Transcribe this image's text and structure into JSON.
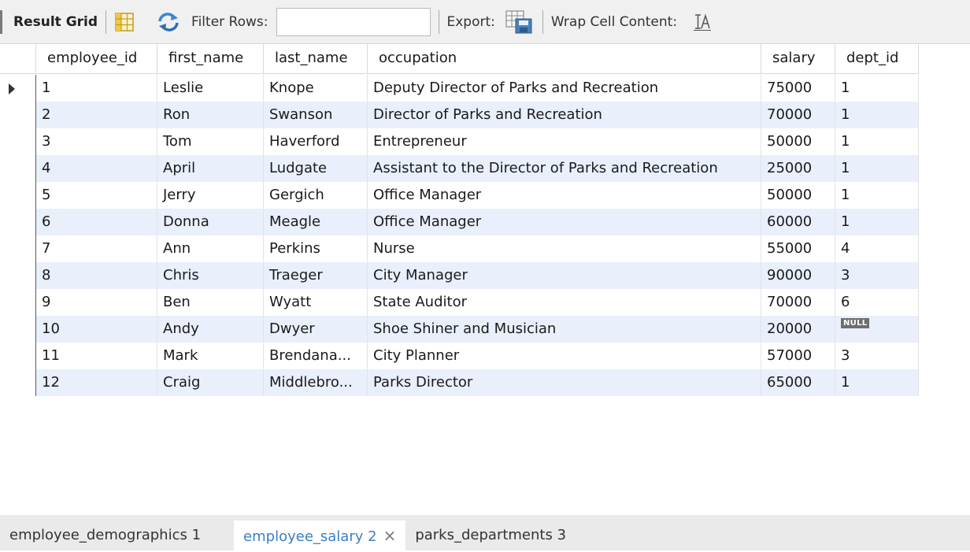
{
  "toolbar": {
    "title": "Result Grid",
    "filter_label": "Filter Rows:",
    "filter_value": "",
    "export_label": "Export:",
    "wrap_label": "Wrap Cell Content:"
  },
  "grid": {
    "columns": [
      "employee_id",
      "first_name",
      "last_name",
      "occupation",
      "salary",
      "dept_id"
    ],
    "rows": [
      {
        "employee_id": "1",
        "first_name": "Leslie",
        "last_name": "Knope",
        "occupation": "Deputy Director of Parks and Recreation",
        "salary": "75000",
        "dept_id": "1"
      },
      {
        "employee_id": "2",
        "first_name": "Ron",
        "last_name": "Swanson",
        "occupation": "Director of Parks and Recreation",
        "salary": "70000",
        "dept_id": "1"
      },
      {
        "employee_id": "3",
        "first_name": "Tom",
        "last_name": "Haverford",
        "occupation": "Entrepreneur",
        "salary": "50000",
        "dept_id": "1"
      },
      {
        "employee_id": "4",
        "first_name": "April",
        "last_name": "Ludgate",
        "occupation": "Assistant to the Director of Parks and Recreation",
        "salary": "25000",
        "dept_id": "1"
      },
      {
        "employee_id": "5",
        "first_name": "Jerry",
        "last_name": "Gergich",
        "occupation": "Office Manager",
        "salary": "50000",
        "dept_id": "1"
      },
      {
        "employee_id": "6",
        "first_name": "Donna",
        "last_name": "Meagle",
        "occupation": "Office Manager",
        "salary": "60000",
        "dept_id": "1"
      },
      {
        "employee_id": "7",
        "first_name": "Ann",
        "last_name": "Perkins",
        "occupation": "Nurse",
        "salary": "55000",
        "dept_id": "4"
      },
      {
        "employee_id": "8",
        "first_name": "Chris",
        "last_name": "Traeger",
        "occupation": "City Manager",
        "salary": "90000",
        "dept_id": "3"
      },
      {
        "employee_id": "9",
        "first_name": "Ben",
        "last_name": "Wyatt",
        "occupation": "State Auditor",
        "salary": "70000",
        "dept_id": "6"
      },
      {
        "employee_id": "10",
        "first_name": "Andy",
        "last_name": "Dwyer",
        "occupation": "Shoe Shiner and Musician",
        "salary": "20000",
        "dept_id": "NULL"
      },
      {
        "employee_id": "11",
        "first_name": "Mark",
        "last_name": "Brendana...",
        "occupation": "City Planner",
        "salary": "57000",
        "dept_id": "3"
      },
      {
        "employee_id": "12",
        "first_name": "Craig",
        "last_name": "Middlebro...",
        "occupation": "Parks Director",
        "salary": "65000",
        "dept_id": "1"
      }
    ]
  },
  "tabs": [
    {
      "label": "employee_demographics 1",
      "active": false
    },
    {
      "label": "employee_salary 2",
      "active": true
    },
    {
      "label": "parks_departments 3",
      "active": false
    }
  ],
  "colors": {
    "alt_row": "#e9f0fb",
    "active_tab_text": "#3a7fc4",
    "toolbar_bg": "#f0f0f0"
  }
}
